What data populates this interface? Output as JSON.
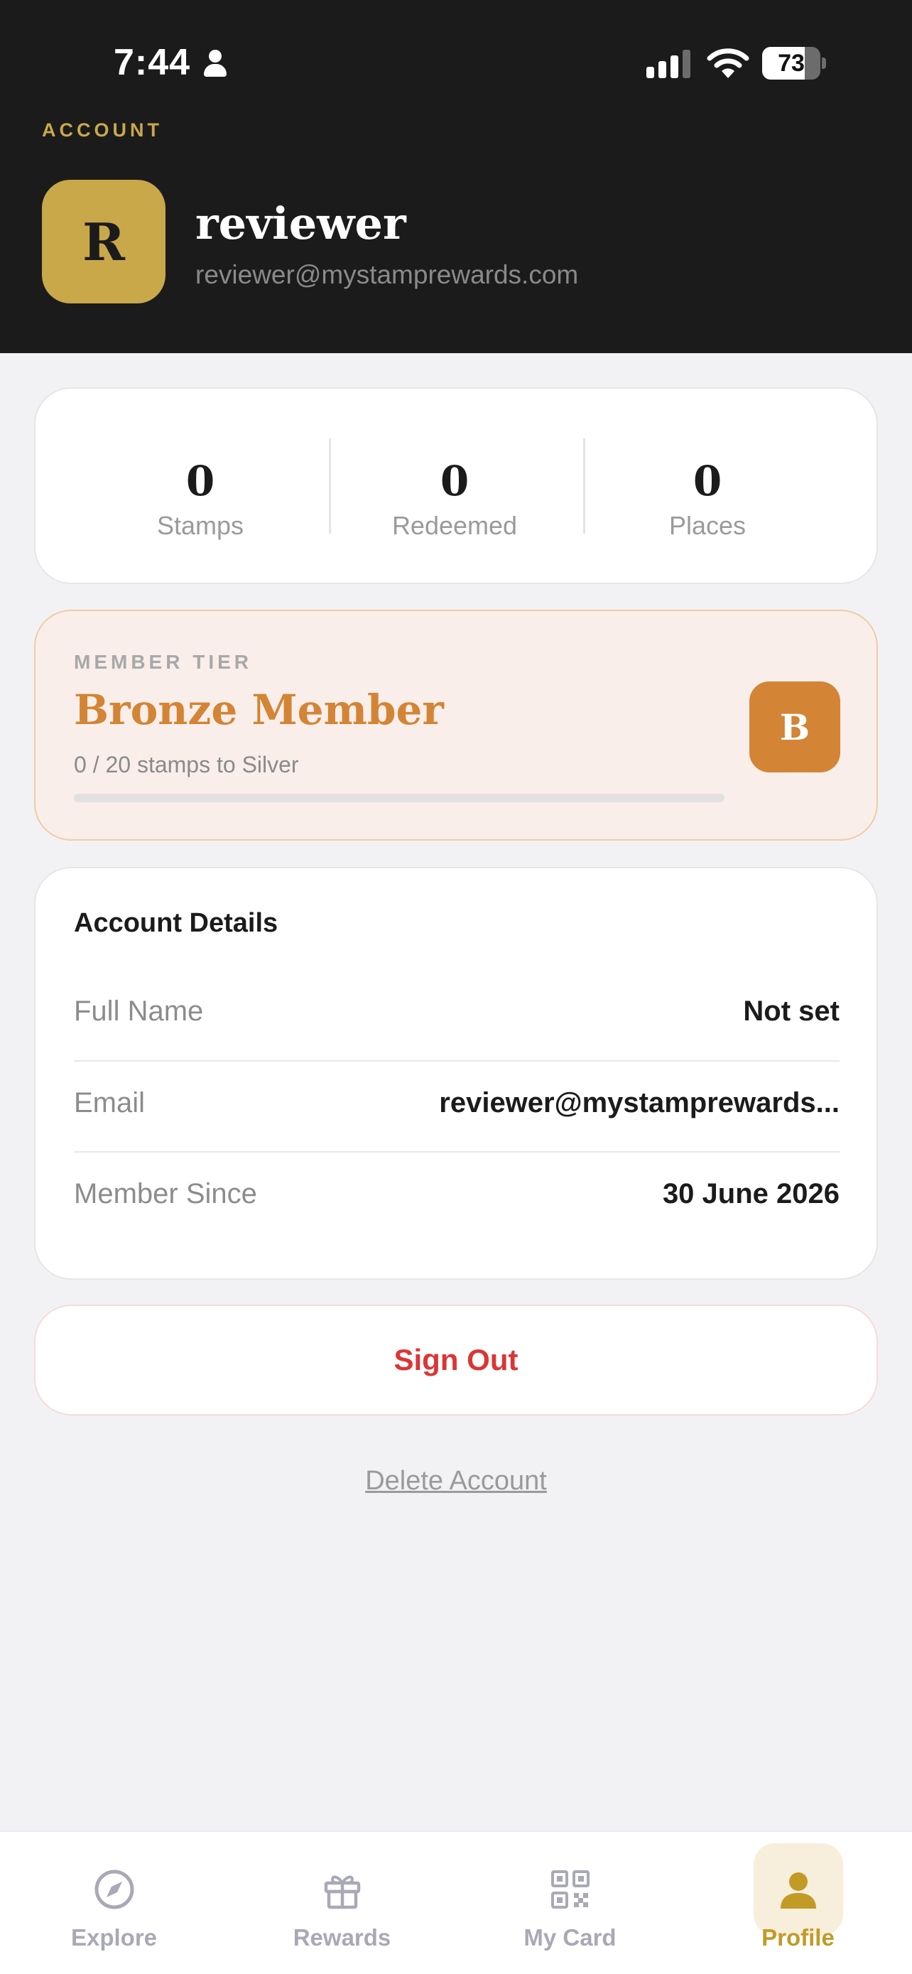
{
  "status_bar": {
    "time": "7:44",
    "battery": "73",
    "battery_level": 0.73
  },
  "header": {
    "section_label": "ACCOUNT",
    "avatar_initial": "R",
    "name": "reviewer",
    "email": "reviewer@mystamprewards.com"
  },
  "stats": [
    {
      "value": "0",
      "label": "Stamps"
    },
    {
      "value": "0",
      "label": "Redeemed"
    },
    {
      "value": "0",
      "label": "Places"
    }
  ],
  "tier": {
    "label": "MEMBER TIER",
    "name": "Bronze Member",
    "progress_text": "0 / 20 stamps to Silver",
    "progress": 0,
    "badge": "B"
  },
  "details": {
    "title": "Account Details",
    "rows": [
      {
        "key": "Full Name",
        "value": "Not set"
      },
      {
        "key": "Email",
        "value": "reviewer@mystamprewards..."
      },
      {
        "key": "Member Since",
        "value": "30 June 2026"
      }
    ]
  },
  "actions": {
    "sign_out": "Sign Out",
    "delete_account": "Delete Account"
  },
  "tabs": [
    {
      "label": "Explore",
      "icon": "compass-icon"
    },
    {
      "label": "Rewards",
      "icon": "gift-icon"
    },
    {
      "label": "My Card",
      "icon": "qr-code-icon"
    },
    {
      "label": "Profile",
      "icon": "person-icon",
      "active": true
    }
  ],
  "colors": {
    "gold": "#c9a84a",
    "bronze": "#d38434",
    "danger": "#dc3535",
    "header_bg": "#1b1b1b"
  }
}
